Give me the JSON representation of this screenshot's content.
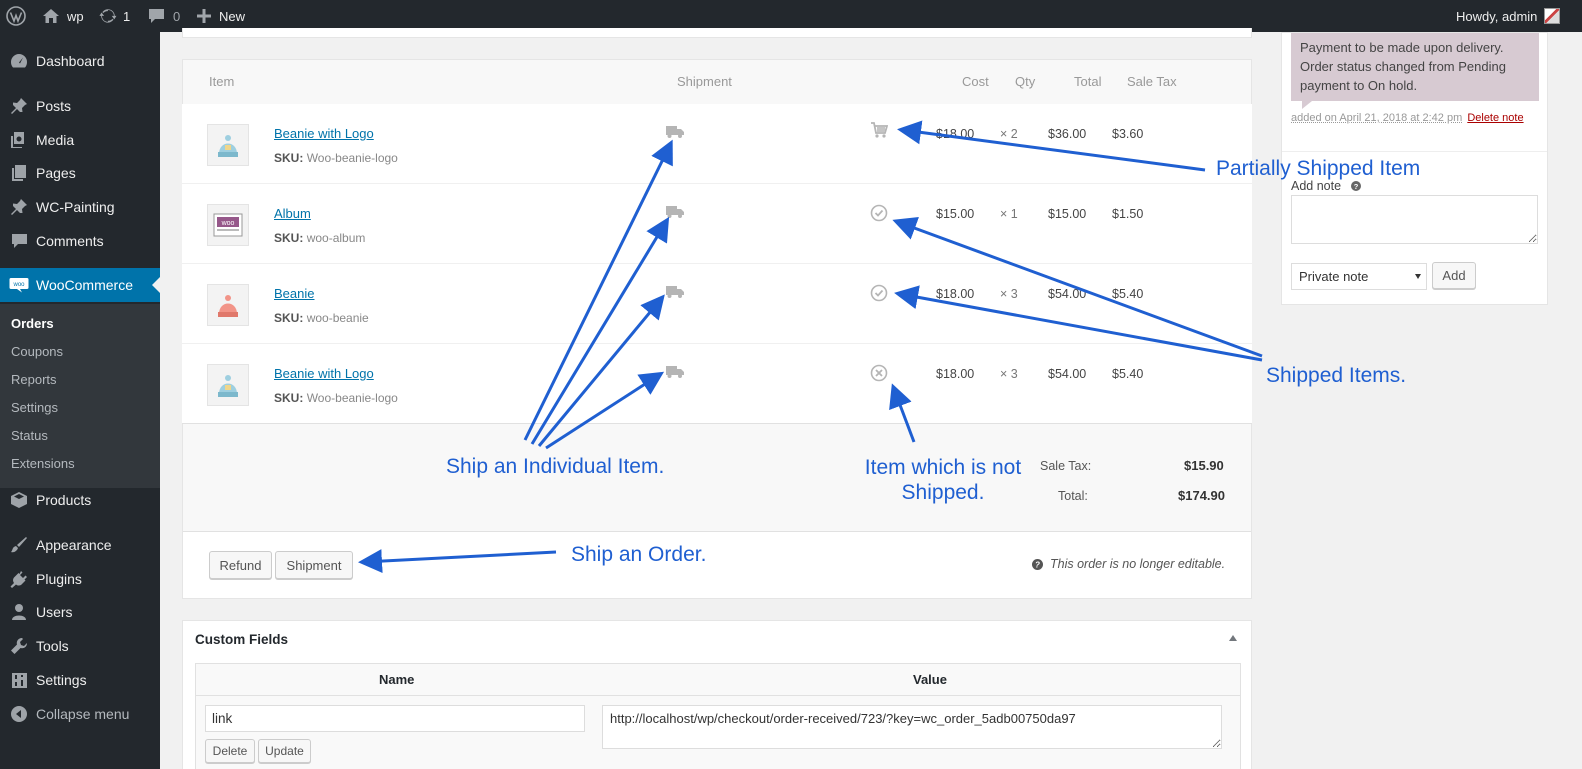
{
  "adminbar": {
    "site_name": "wp",
    "updates_count": "1",
    "comments_count": "0",
    "new_label": "New",
    "howdy": "Howdy, admin"
  },
  "sidebar": {
    "items": [
      {
        "label": "Dashboard",
        "icon": "dashboard-icon"
      },
      {
        "label": "Posts",
        "icon": "pin-icon"
      },
      {
        "label": "Media",
        "icon": "media-icon"
      },
      {
        "label": "Pages",
        "icon": "pages-icon"
      },
      {
        "label": "WC-Painting",
        "icon": "pin-icon"
      },
      {
        "label": "Comments",
        "icon": "comment-icon"
      },
      {
        "label": "WooCommerce",
        "icon": "woocommerce-icon"
      },
      {
        "label": "Products",
        "icon": "box-icon"
      },
      {
        "label": "Appearance",
        "icon": "brush-icon"
      },
      {
        "label": "Plugins",
        "icon": "plug-icon"
      },
      {
        "label": "Users",
        "icon": "user-icon"
      },
      {
        "label": "Tools",
        "icon": "wrench-icon"
      },
      {
        "label": "Settings",
        "icon": "settings-icon"
      },
      {
        "label": "Collapse menu",
        "icon": "collapse-icon"
      }
    ],
    "submenu": [
      "Orders",
      "Coupons",
      "Reports",
      "Settings",
      "Status",
      "Extensions"
    ]
  },
  "items_table": {
    "headers": {
      "item": "Item",
      "shipment": "Shipment",
      "cost": "Cost",
      "qty": "Qty",
      "total": "Total",
      "tax": "Sale Tax"
    },
    "sku_label": "SKU:",
    "rows": [
      {
        "name": "Beanie with Logo",
        "sku": "Woo-beanie-logo",
        "cost": "$18.00",
        "qty": "× 2",
        "total": "$36.00",
        "tax": "$3.60",
        "status": "partial"
      },
      {
        "name": "Album",
        "sku": "woo-album",
        "cost": "$15.00",
        "qty": "× 1",
        "total": "$15.00",
        "tax": "$1.50",
        "status": "shipped"
      },
      {
        "name": "Beanie",
        "sku": "woo-beanie",
        "cost": "$18.00",
        "qty": "× 3",
        "total": "$54.00",
        "tax": "$5.40",
        "status": "shipped"
      },
      {
        "name": "Beanie with Logo",
        "sku": "Woo-beanie-logo",
        "cost": "$18.00",
        "qty": "× 3",
        "total": "$54.00",
        "tax": "$5.40",
        "status": "not-shipped"
      }
    ],
    "totals": {
      "sale_tax_label": "Sale Tax:",
      "sale_tax": "$15.90",
      "total_label": "Total:",
      "total": "$174.90"
    }
  },
  "actions": {
    "refund": "Refund",
    "shipment": "Shipment",
    "not_editable": "This order is no longer editable."
  },
  "custom_fields": {
    "title": "Custom Fields",
    "name_header": "Name",
    "value_header": "Value",
    "name_value": "link",
    "value_value": "http://localhost/wp/checkout/order-received/723/?key=wc_order_5adb00750da97",
    "delete": "Delete",
    "update": "Update"
  },
  "notes": {
    "note_text": "Payment to be made upon delivery. Order status changed from Pending payment to On hold.",
    "meta": "added on April 21, 2018 at 2:42 pm",
    "delete_note": "Delete note",
    "add_note_label": "Add note",
    "note_type": "Private note",
    "add_button": "Add"
  },
  "annotations": {
    "partial": "Partially Shipped Item",
    "shipped": "Shipped Items.",
    "individual": "Ship an Individual Item.",
    "not_shipped_line1": "Item which is not",
    "not_shipped_line2": "Shipped.",
    "order": "Ship an Order."
  },
  "colors": {
    "accent": "#0073aa",
    "annotation": "#1f5fd1",
    "sidebar": "#23282d",
    "note_bg": "#d7cad2"
  }
}
